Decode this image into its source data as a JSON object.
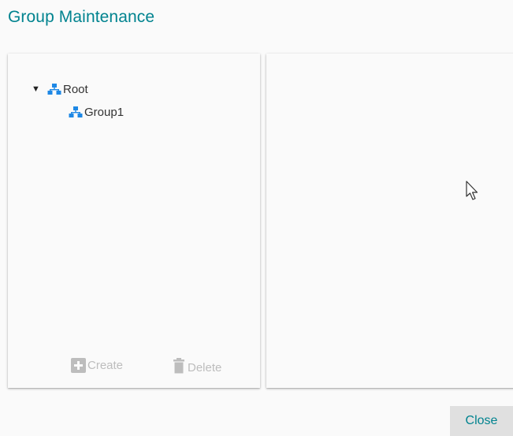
{
  "dialog": {
    "title": "Group Maintenance"
  },
  "tree": {
    "root": {
      "label": "Root",
      "expanded": true,
      "toggle_icon": "▼",
      "icon": "network-group-icon"
    },
    "children": [
      {
        "label": "Group1",
        "icon": "network-group-icon"
      }
    ]
  },
  "actions": {
    "create_label": "Create",
    "create_icon": "plus-box-icon",
    "delete_label": "Delete",
    "delete_icon": "trash-icon"
  },
  "footer": {
    "close_label": "Close"
  },
  "colors": {
    "accent": "#00838f",
    "node_icon": "#1e88e5",
    "disabled": "#bdbdbd",
    "button_bg": "#e0e0e0"
  }
}
